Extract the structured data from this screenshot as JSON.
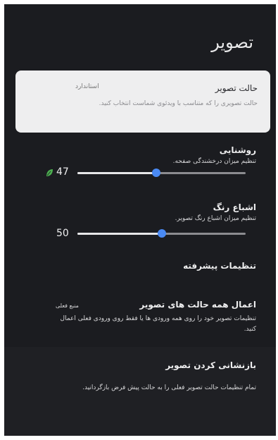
{
  "page": {
    "title": "تصویر"
  },
  "picture_mode": {
    "label": "حالت تصویر",
    "value": "استاندارد",
    "description": "حالت تصویری را که متناسب با ویدئوی شماست انتخاب کنید."
  },
  "brightness": {
    "label": "روشنایی",
    "description": "تنظیم میزان درخشندگی صفحه.",
    "value": "47",
    "level": 47,
    "leaf_icon": "eco-leaf-icon",
    "leaf_color": "#4caf50"
  },
  "saturation": {
    "label": "اشباع رنگ",
    "description": "تنظیم میزان اشباع رنگ تصویر.",
    "value": "50",
    "level": 50
  },
  "advanced": {
    "label": "تنظیمات پیشرفته"
  },
  "apply_all": {
    "label": "اعمال همه حالت های تصویر",
    "value": "منبع فعلی",
    "description_line1": "تنظیمات تصویر خود را روی همه ورودی ها یا فقط روی ورودی فعلی اعمال",
    "description_line2": "کنید."
  },
  "reset": {
    "label": "بازنشانی کردن تصویر",
    "description": "تمام تنظیمات حالت تصویر فعلی را به حالت پیش فرض بازگردانید."
  },
  "colors": {
    "accent": "#4a8af4",
    "background": "#1b1c20",
    "card": "#eeeeef"
  }
}
